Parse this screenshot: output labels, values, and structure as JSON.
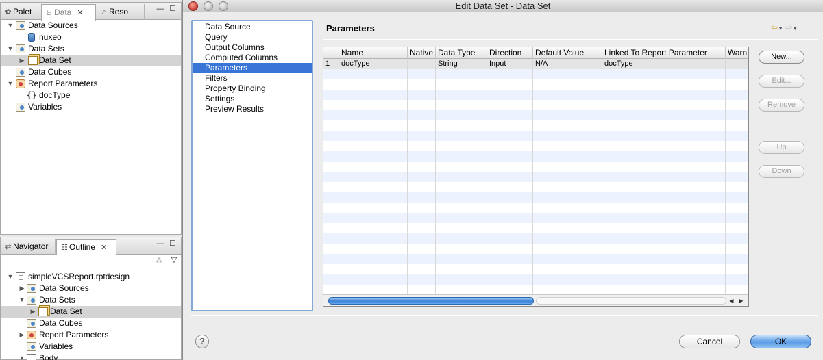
{
  "data_panel": {
    "tabs": [
      {
        "label": "Palet",
        "icon": "palette-icon"
      },
      {
        "label": "Data",
        "icon": "data-explorer-icon"
      },
      {
        "label": "Reso",
        "icon": "resource-explorer-icon"
      }
    ],
    "tree": [
      {
        "label": "Data Sources",
        "icon": "folder-icon",
        "expanded": true
      },
      {
        "label": "nuxeo",
        "icon": "database-icon"
      },
      {
        "label": "Data Sets",
        "icon": "folder-icon",
        "expanded": true
      },
      {
        "label": "Data Set",
        "icon": "dataset-icon",
        "selected": true
      },
      {
        "label": "Data Cubes",
        "icon": "folder-icon"
      },
      {
        "label": "Report Parameters",
        "icon": "report-parameters-icon",
        "expanded": true
      },
      {
        "label": "docType",
        "icon": "parameter-icon"
      },
      {
        "label": "Variables",
        "icon": "folder-icon"
      }
    ]
  },
  "outline_panel": {
    "tabs": [
      {
        "label": "Navigator",
        "icon": "navigator-icon"
      },
      {
        "label": "Outline",
        "icon": "outline-icon"
      }
    ],
    "tree": [
      {
        "label": "simpleVCSReport.rptdesign",
        "icon": "file-icon",
        "expanded": true
      },
      {
        "label": "Data Sources",
        "icon": "folder-icon"
      },
      {
        "label": "Data Sets",
        "icon": "folder-icon",
        "expanded": true
      },
      {
        "label": "Data Set",
        "icon": "dataset-icon",
        "selected": true
      },
      {
        "label": "Data Cubes",
        "icon": "folder-icon"
      },
      {
        "label": "Report Parameters",
        "icon": "report-parameters-icon"
      },
      {
        "label": "Variables",
        "icon": "folder-icon"
      },
      {
        "label": "Body",
        "icon": "file-icon",
        "expanded": true
      }
    ]
  },
  "dialog": {
    "title": "Edit Data Set - Data Set",
    "nav_items": [
      "Data Source",
      "Query",
      "Output Columns",
      "Computed Columns",
      "Parameters",
      "Filters",
      "Property Binding",
      "Settings",
      "Preview Results"
    ],
    "selected_nav": "Parameters",
    "heading": "Parameters",
    "table": {
      "columns": [
        "",
        "Name",
        "Native",
        "Data Type",
        "Direction",
        "Default Value",
        "Linked To Report Parameter",
        "Warni"
      ],
      "rows": [
        [
          "1",
          "docType",
          "",
          "String",
          "Input",
          "N/A",
          "docType",
          ""
        ]
      ]
    },
    "side_buttons": [
      {
        "label": "New...",
        "enabled": true
      },
      {
        "label": "Edit...",
        "enabled": false
      },
      {
        "label": "Remove",
        "enabled": false
      },
      {
        "label": "Up",
        "enabled": false
      },
      {
        "label": "Down",
        "enabled": false
      }
    ],
    "help_label": "?",
    "cancel_label": "Cancel",
    "ok_label": "OK"
  },
  "colors": {
    "selection": "#3875d7",
    "row_stripe": "#edf3fe",
    "ok_button": "#5a9ae6"
  }
}
